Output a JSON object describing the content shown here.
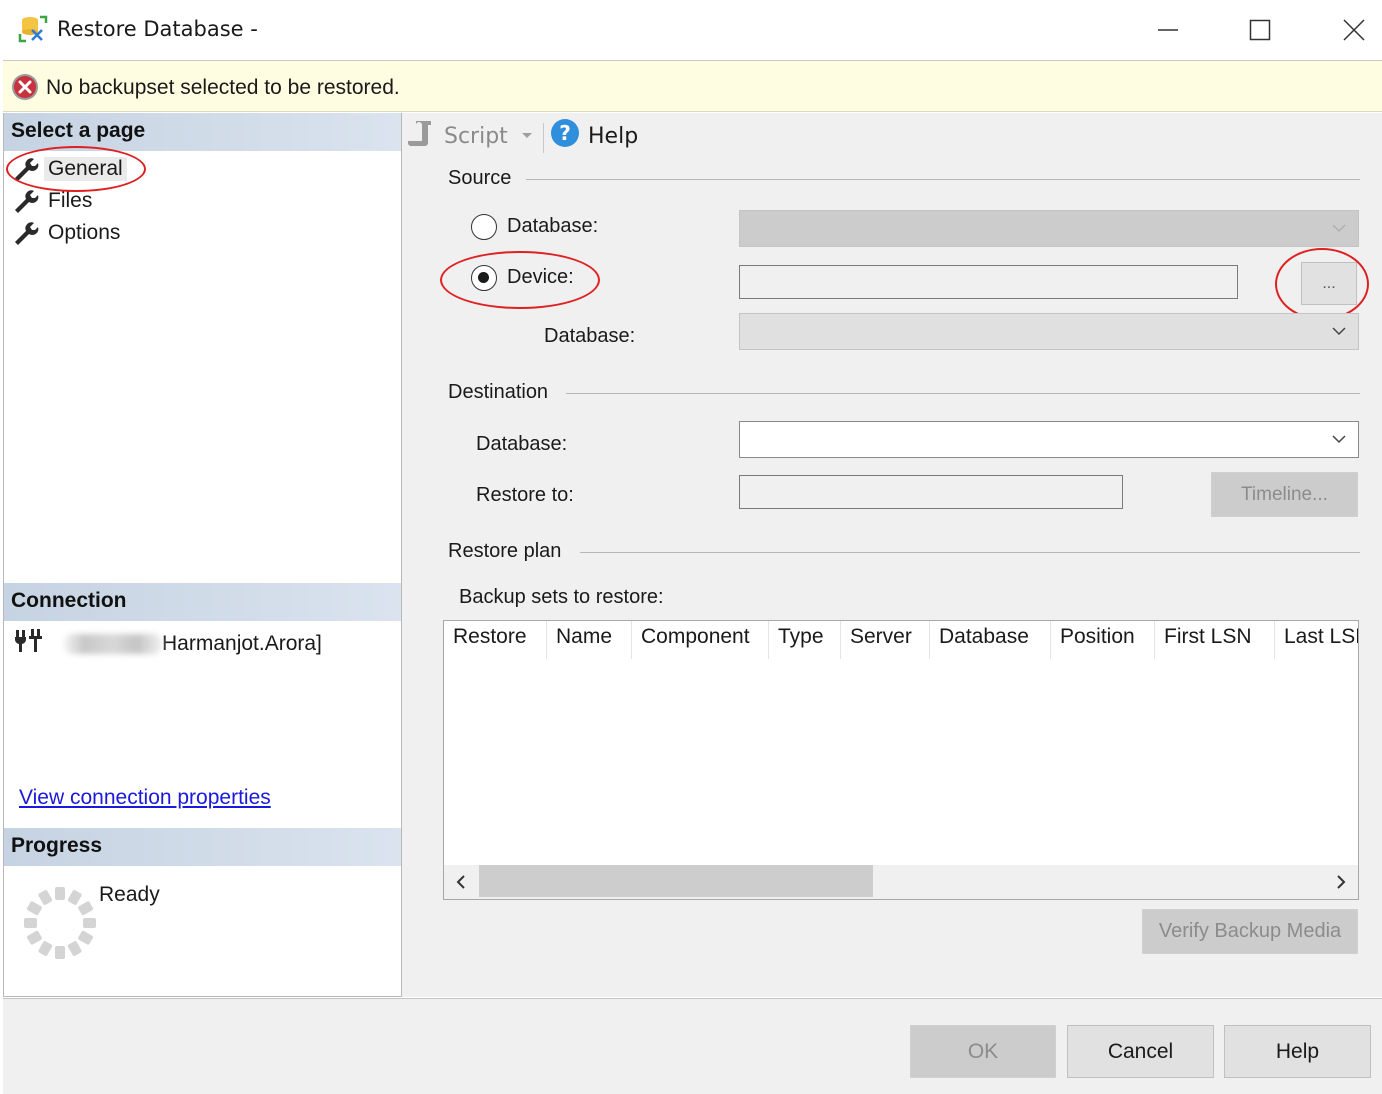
{
  "window": {
    "title": "Restore Database -",
    "app_icon": "restore-database-icon",
    "controls": {
      "minimize": "minimize-icon",
      "maximize": "maximize-icon",
      "close": "close-icon"
    }
  },
  "banner": {
    "icon": "error-icon",
    "message": "No backupset selected to be restored."
  },
  "left_pane": {
    "select_page_header": "Select a page",
    "pages": [
      {
        "label": "General",
        "icon": "wrench-icon",
        "selected": true
      },
      {
        "label": "Files",
        "icon": "wrench-icon",
        "selected": false
      },
      {
        "label": "Options",
        "icon": "wrench-icon",
        "selected": false
      }
    ],
    "connection_header": "Connection",
    "connection": {
      "icon": "connection-plug-icon",
      "user_visible": "Harmanjot.Arora]",
      "redacted": true
    },
    "view_connection_link": "View connection properties",
    "progress_header": "Progress",
    "progress_status": "Ready",
    "progress_icon": "spinner-icon"
  },
  "toolbar": {
    "script_label": "Script",
    "script_icon": "script-icon",
    "help_label": "Help",
    "help_icon": "help-icon"
  },
  "source": {
    "header": "Source",
    "options": [
      {
        "label": "Database:",
        "selected": false
      },
      {
        "label": "Device:",
        "selected": true
      }
    ],
    "database_combo_value": "",
    "device_value": "",
    "browse_button": "...",
    "device_database_label": "Database:",
    "device_database_value": ""
  },
  "destination": {
    "header": "Destination",
    "database_label": "Database:",
    "database_value": "",
    "restore_to_label": "Restore to:",
    "restore_to_value": "",
    "timeline_button": "Timeline..."
  },
  "restore_plan": {
    "header": "Restore plan",
    "backup_sets_label": "Backup sets to restore:",
    "columns": [
      "Restore",
      "Name",
      "Component",
      "Type",
      "Server",
      "Database",
      "Position",
      "First LSN",
      "Last LSN"
    ],
    "rows": [],
    "verify_button": "Verify Backup Media"
  },
  "footer": {
    "ok": "OK",
    "cancel": "Cancel",
    "help": "Help"
  },
  "colors": {
    "banner_bg": "#fffde1",
    "error_red": "#c8323c",
    "link_blue": "#1a1adc",
    "annotation_red": "#e02020",
    "section_header": "#c6d3e2"
  }
}
